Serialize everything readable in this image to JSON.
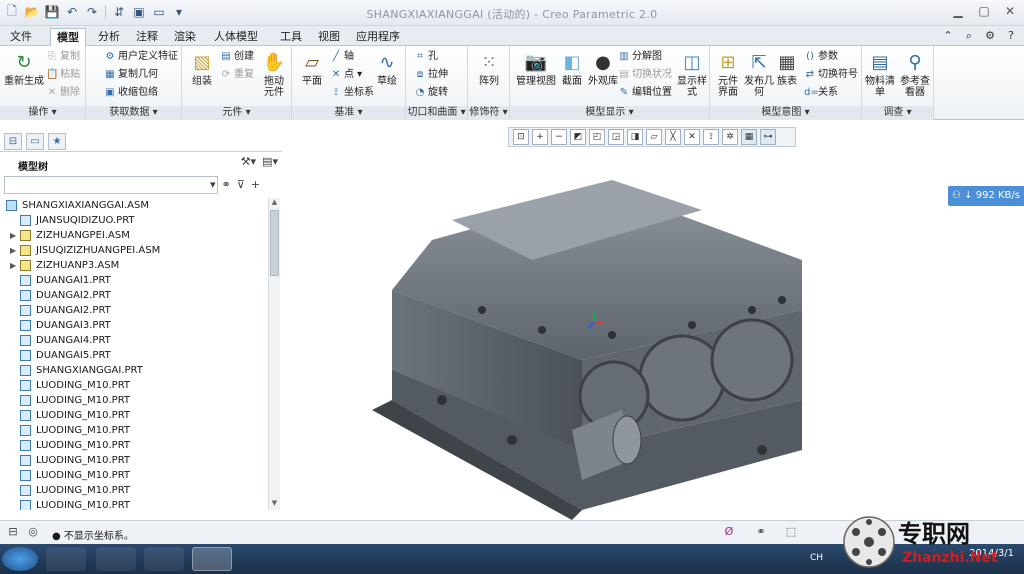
{
  "window": {
    "title": "SHANGXIAXIANGGAI (活动的) - Creo Parametric 2.0"
  },
  "tabs": [
    "文件",
    "模型",
    "分析",
    "注释",
    "渲染",
    "人体模型",
    "工具",
    "视图",
    "应用程序"
  ],
  "active_tab": "模型",
  "ribbon": {
    "operations": {
      "label": "操作",
      "regenerate": "重新生成",
      "copy": "复制",
      "paste": "粘贴",
      "delete": "删除"
    },
    "get_data": {
      "label": "获取数据",
      "udf": "用户定义特征",
      "copy_geom": "复制几何",
      "shrinkwrap": "收缩包络"
    },
    "component": {
      "label": "元件",
      "assemble": "组装",
      "create": "创建",
      "repeat": "重复",
      "drag": "拖动元件"
    },
    "datum": {
      "label": "基准",
      "plane": "平面",
      "axis": "轴",
      "point": "点",
      "csys": "坐标系",
      "sketch": "草绘"
    },
    "cut_surface": {
      "label": "切口和曲面",
      "hole": "孔",
      "extrude": "拉伸",
      "revolve": "旋转"
    },
    "modifiers": {
      "label": "修饰符",
      "pattern": "阵列"
    },
    "model_display": {
      "label": "模型显示",
      "manage_views": "管理视图",
      "section": "截面",
      "appearance": "外观库",
      "explode": "分解图",
      "toggle_status": "切换状况",
      "edit_position": "编辑位置",
      "display_style": "显示样式"
    },
    "model_intent": {
      "label": "模型意图",
      "comp_interface": "元件界面",
      "publish_geom": "发布几何",
      "table": "族表",
      "params": "参数",
      "switch_symbol": "切换符号",
      "relations": "关系"
    },
    "investigate": {
      "label": "调查",
      "bom": "物料清单",
      "ref_viewer": "参考查看器"
    }
  },
  "model_tree": {
    "title": "模型树",
    "items": [
      {
        "name": "SHANGXIAXIANGGAI.ASM",
        "type": "top",
        "level": 0,
        "expandable": false
      },
      {
        "name": "JIANSUQIDIZUO.PRT",
        "type": "prt",
        "level": 1,
        "expandable": false
      },
      {
        "name": "ZIZHUANGPEI.ASM",
        "type": "asm",
        "level": 1,
        "expandable": true
      },
      {
        "name": "JISUQIZIZHUANGPEI.ASM",
        "type": "asm",
        "level": 1,
        "expandable": true
      },
      {
        "name": "ZIZHUANP3.ASM",
        "type": "asm",
        "level": 1,
        "expandable": true
      },
      {
        "name": "DUANGAI1.PRT",
        "type": "prt",
        "level": 1,
        "expandable": false
      },
      {
        "name": "DUANGAI2.PRT",
        "type": "prt",
        "level": 1,
        "expandable": false
      },
      {
        "name": "DUANGAI2.PRT",
        "type": "prt",
        "level": 1,
        "expandable": false
      },
      {
        "name": "DUANGAI3.PRT",
        "type": "prt",
        "level": 1,
        "expandable": false
      },
      {
        "name": "DUANGAI4.PRT",
        "type": "prt",
        "level": 1,
        "expandable": false
      },
      {
        "name": "DUANGAI5.PRT",
        "type": "prt",
        "level": 1,
        "expandable": false
      },
      {
        "name": "SHANGXIANGGAI.PRT",
        "type": "prt",
        "level": 1,
        "expandable": false
      },
      {
        "name": "LUODING_M10.PRT",
        "type": "prt",
        "level": 1,
        "expandable": false
      },
      {
        "name": "LUODING_M10.PRT",
        "type": "prt",
        "level": 1,
        "expandable": false
      },
      {
        "name": "LUODING_M10.PRT",
        "type": "prt",
        "level": 1,
        "expandable": false
      },
      {
        "name": "LUODING_M10.PRT",
        "type": "prt",
        "level": 1,
        "expandable": false
      },
      {
        "name": "LUODING_M10.PRT",
        "type": "prt",
        "level": 1,
        "expandable": false
      },
      {
        "name": "LUODING_M10.PRT",
        "type": "prt",
        "level": 1,
        "expandable": false
      },
      {
        "name": "LUODING_M10.PRT",
        "type": "prt",
        "level": 1,
        "expandable": false
      },
      {
        "name": "LUODING_M10.PRT",
        "type": "prt",
        "level": 1,
        "expandable": false
      },
      {
        "name": "LUODING_M10.PRT",
        "type": "prt",
        "level": 1,
        "expandable": false
      }
    ]
  },
  "network_speed": "992 KB/s",
  "status": {
    "message": "不显示坐标系。"
  },
  "taskbar": {
    "tray": "CH",
    "date": "2014/3/1"
  },
  "watermark": {
    "text": "专职网",
    "site": "Zhanzhi.Net"
  }
}
